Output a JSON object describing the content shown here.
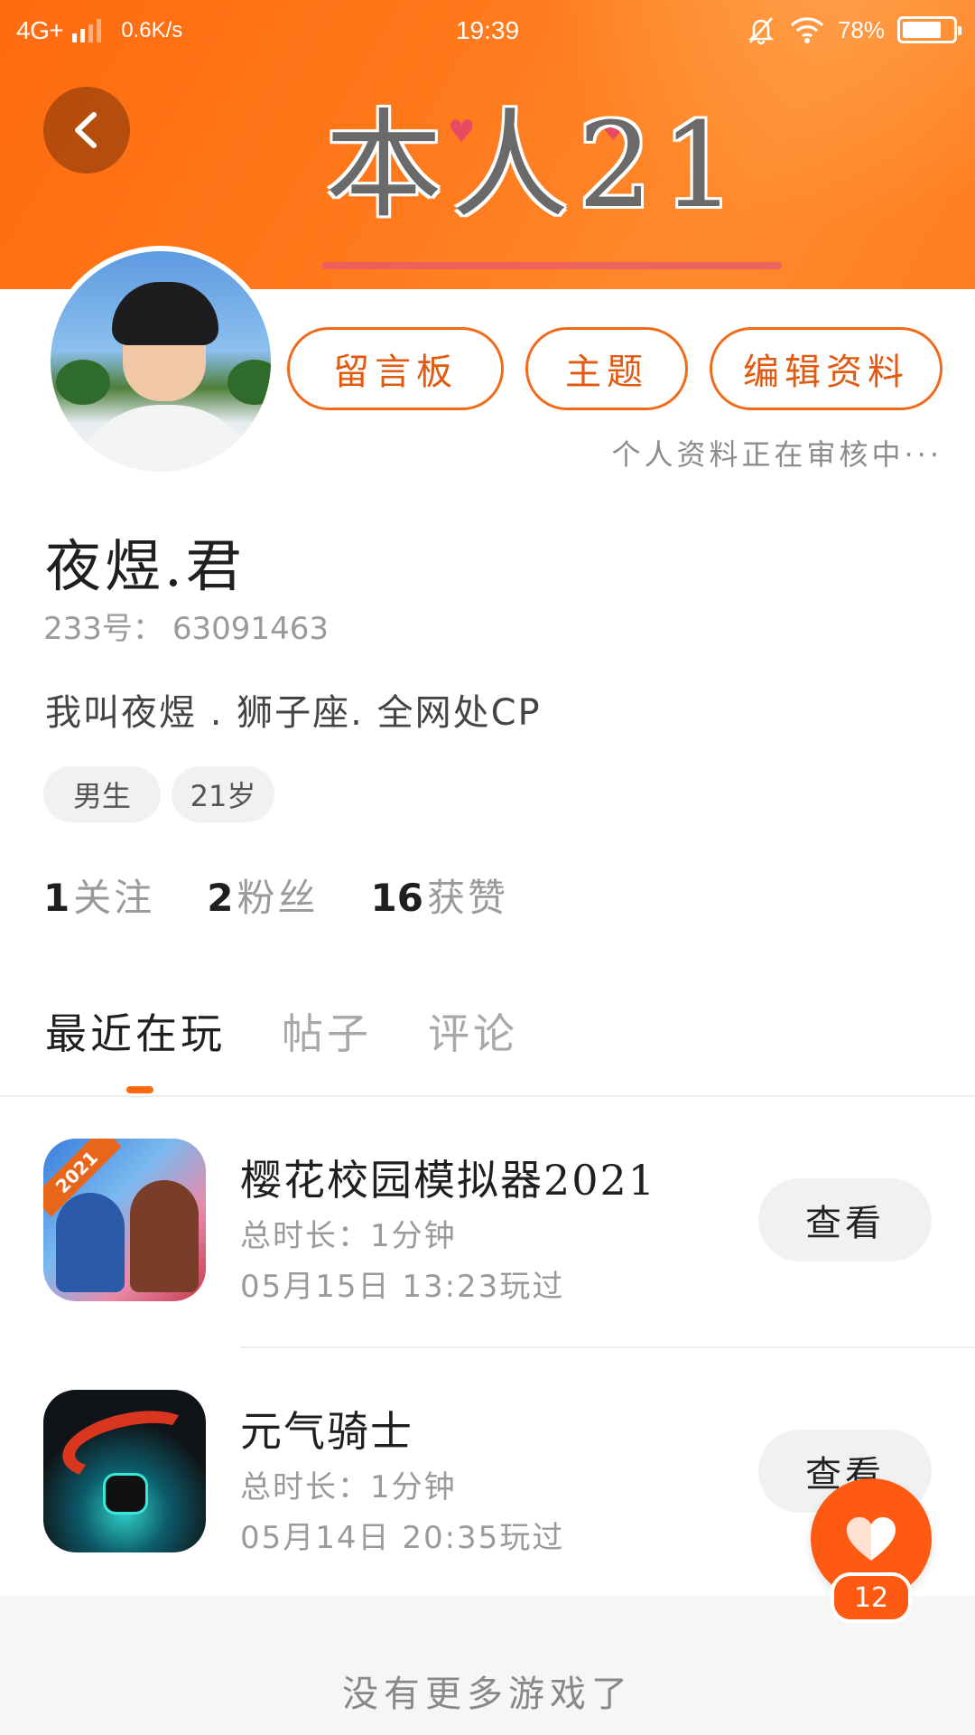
{
  "status_bar": {
    "network": "4G+",
    "speed": "0.6K/s",
    "time": "19:39",
    "battery": "78%",
    "battery_level": 0.78
  },
  "header": {
    "banner_text": "本人21",
    "colors": {
      "primary": "#ff6a10",
      "accent_text": "#e25a10"
    }
  },
  "actions": {
    "message_board": "留言板",
    "theme": "主题",
    "edit_profile": "编辑资料",
    "review_note": "个人资料正在审核中···"
  },
  "profile": {
    "nickname": "夜煜.君",
    "uid_label": "233号：",
    "uid_value": "63091463",
    "bio": "我叫夜煜 . 狮子座. 全网处CP",
    "tags": [
      "男生",
      "21岁"
    ],
    "stats": [
      {
        "num": "1",
        "label": "关注"
      },
      {
        "num": "2",
        "label": "粉丝"
      },
      {
        "num": "16",
        "label": "获赞"
      }
    ]
  },
  "tabs": [
    {
      "label": "最近在玩",
      "active": true
    },
    {
      "label": "帖子",
      "active": false
    },
    {
      "label": "评论",
      "active": false
    }
  ],
  "games": [
    {
      "name": "樱花校园模拟器2021",
      "icon_badge": "2021",
      "duration": "总时长：1分钟",
      "last_played": "05月15日  13:23玩过",
      "button": "查看"
    },
    {
      "name": "元气骑士",
      "duration": "总时长：1分钟",
      "last_played": "05月14日  20:35玩过",
      "button": "查看"
    }
  ],
  "footer": {
    "text": "没有更多游戏了"
  },
  "like_fab": {
    "count": "12"
  }
}
